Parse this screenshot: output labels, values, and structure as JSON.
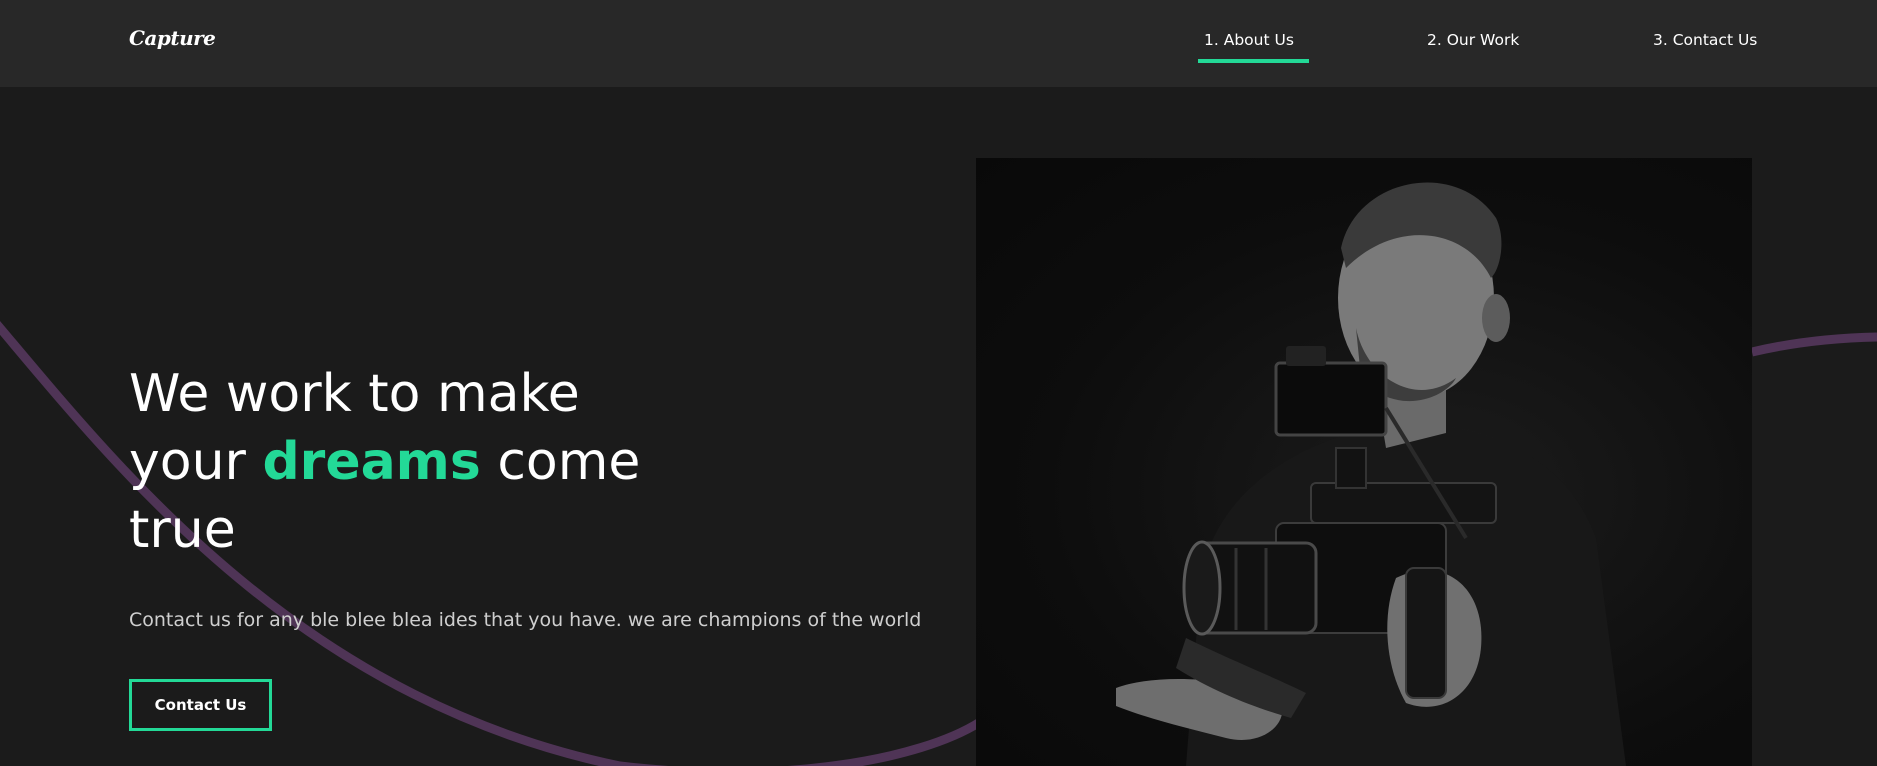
{
  "header": {
    "logo": "Capture",
    "nav": [
      {
        "label": "1. About Us",
        "active": true
      },
      {
        "label": "2. Our Work",
        "active": false
      },
      {
        "label": "3. Contact Us",
        "active": false
      }
    ]
  },
  "hero": {
    "headline_line1": "We work to make",
    "headline_line2_pre": "your ",
    "headline_line2_accent": "dreams",
    "headline_line2_post": " come",
    "headline_line3": "true",
    "description": "Contact us for any ble blee blea ides that you have. we are champions of the world",
    "cta_label": "Contact Us"
  },
  "colors": {
    "background": "#1b1b1b",
    "header": "#282828",
    "accent": "#23d997",
    "curve": "#5b3a60"
  },
  "icons": {
    "photo": "camera-operator-photo"
  }
}
